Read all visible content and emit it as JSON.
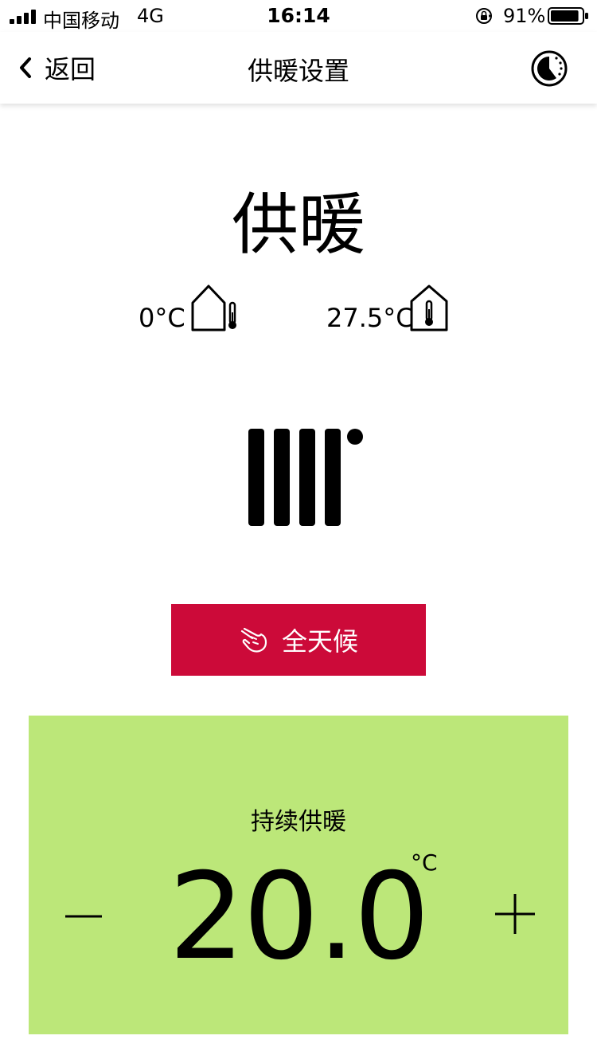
{
  "status_bar": {
    "carrier": "中国移动",
    "network": "4G",
    "time": "16:14",
    "battery_percent": "91%",
    "battery_level": 0.91
  },
  "nav": {
    "back_label": "返回",
    "title": "供暖设置",
    "right_icon": "clock-icon"
  },
  "main": {
    "mode_title": "供暖",
    "outdoor_temp": "0°C",
    "outdoor_icon": "house-outdoor-thermometer-icon",
    "indoor_temp": "27.5°C",
    "indoor_icon": "house-indoor-thermometer-icon",
    "device_icon": "radiator-icon",
    "schedule_button_label": "全天候",
    "schedule_icon": "hand-pointer-icon"
  },
  "panel": {
    "title": "持续供暖",
    "setpoint": "20.0",
    "unit": "°C",
    "background": "#bce779"
  },
  "colors": {
    "accent_red": "#cc0a39",
    "panel_green": "#bce779"
  }
}
